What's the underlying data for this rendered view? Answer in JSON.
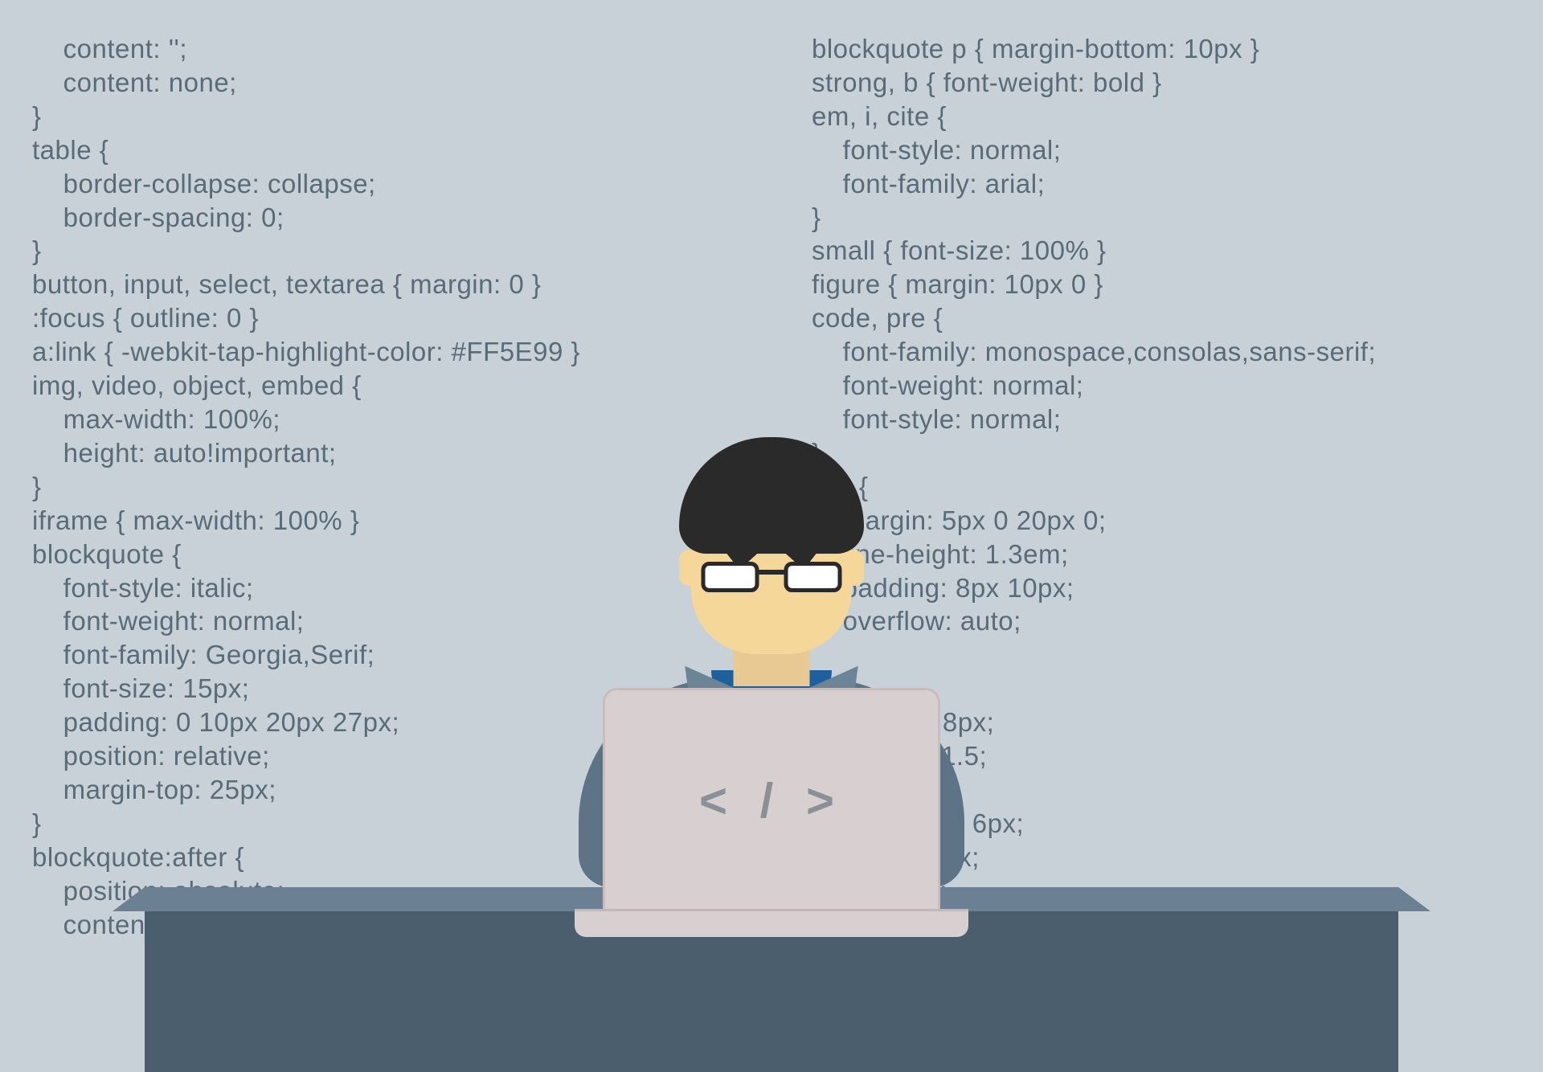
{
  "code": {
    "left": "    content: '';\n    content: none;\n}\ntable {\n    border-collapse: collapse;\n    border-spacing: 0;\n}\nbutton, input, select, textarea { margin: 0 }\n:focus { outline: 0 }\na:link { -webkit-tap-highlight-color: #FF5E99 }\nimg, video, object, embed {\n    max-width: 100%;\n    height: auto!important;\n}\niframe { max-width: 100% }\nblockquote {\n    font-style: italic;\n    font-weight: normal;\n    font-family: Georgia,Serif;\n    font-size: 15px;\n    padding: 0 10px 20px 27px;\n    position: relative;\n    margin-top: 25px;\n}\nblockquote:after {\n    position: absolute;\n    content: '\"';",
    "right": "blockquote p { margin-bottom: 10px }\nstrong, b { font-weight: bold }\nem, i, cite {\n    font-style: normal;\n    font-family: arial;\n}\nsmall { font-size: 100% }\nfigure { margin: 10px 0 }\ncode, pre {\n    font-family: monospace,consolas,sans-serif;\n    font-weight: normal;\n    font-style: normal;\n}\npre {\n    margin: 5px 0 20px 0;\n    line-height: 1.3em;\n    padding: 8px 10px;\n    overflow: auto;\n\n    {\n        ng: 0 8px;\n       eight: 1.5;\n\n            : 1px 6px;\n            0 2px;\n           ack:"
  },
  "laptop": {
    "symbol": "< / >"
  }
}
